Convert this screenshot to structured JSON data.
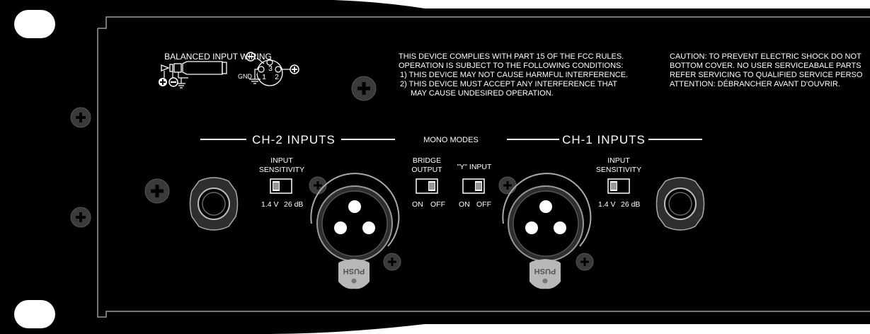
{
  "diagram": {
    "balanced_input_wiring": {
      "title": "BALANCED INPUT WIRING",
      "gnd_label": "GND",
      "pin_1": "1",
      "pin_2": "2",
      "pin_3": "3"
    },
    "fcc_notice": {
      "line1": "THIS DEVICE COMPLIES WITH PART 15 OF THE FCC RULES.",
      "line2": "OPERATION IS SUBJECT TO THE FOLLOWING CONDITIONS:",
      "line3": "1) THIS DEVICE MAY NOT CAUSE HARMFUL INTERFERENCE.",
      "line4": "2) THIS DEVICE MUST ACCEPT ANY INTERFERENCE THAT",
      "line5": "MAY CAUSE UNDESIRED OPERATION."
    },
    "caution": {
      "line1": "CAUTION: TO PREVENT ELECTRIC SHOCK DO NOT",
      "line2": "BOTTOM COVER. NO USER SERVICEABALE PARTS",
      "line3": "REFER SERVICING TO QUALIFIED SERVICE PERSO",
      "line4": "ATTENTION: DÉBRANCHER AVANT D'OUVRIR."
    },
    "ch2_inputs": "CH-2 INPUTS",
    "ch1_inputs": "CH-1 INPUTS",
    "mono_modes": "MONO MODES",
    "ch2_sensitivity": {
      "line1": "INPUT",
      "line2": "SENSITIVITY",
      "left": "1.4 V",
      "right": "26 dB"
    },
    "ch1_sensitivity": {
      "line1": "INPUT",
      "line2": "SENSITIVITY",
      "left": "1.4 V",
      "right": "26 dB"
    },
    "bridge_output": {
      "line1": "BRIDGE",
      "line2": "OUTPUT",
      "on": "ON",
      "off": "OFF"
    },
    "y_input": {
      "label": "\"Y\" INPUT",
      "on": "ON",
      "off": "OFF"
    },
    "xlr_ch2_push": "PUSH",
    "xlr_ch1_push": "PUSH"
  }
}
